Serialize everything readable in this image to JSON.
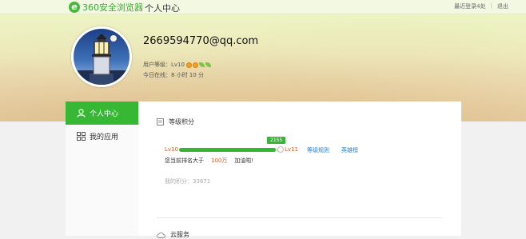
{
  "topbar": {
    "logo_text": "360安全浏览器",
    "page_title": "个人中心",
    "recent_login": "最近登录4处",
    "logout": "退出"
  },
  "user": {
    "email": "2669594770@qq.com",
    "level_label": "用户等级：Lv10",
    "online_label": "今日在线：8 小时 10 分"
  },
  "sidebar": {
    "items": [
      {
        "label": "个人中心",
        "icon": "user-icon",
        "active": true
      },
      {
        "label": "我的应用",
        "icon": "apps-grid-icon",
        "active": false
      }
    ]
  },
  "level_section": {
    "title": "等级积分",
    "current_level": "Lv10",
    "next_level": "Lv11",
    "progress_value": "2155",
    "progress_fraction": 0.95,
    "link_rules": "等级规则",
    "link_rank": "英雄榜",
    "rank_prefix": "您当前排名大于",
    "rank_value": "100万",
    "rank_suffix": "加油啦!",
    "points_text": "我的积分：33671"
  },
  "cloud_section": {
    "title": "云服务"
  },
  "colors": {
    "accent_green": "#37b834",
    "level_orange": "#e25a1f",
    "link_blue": "#2a7fc9"
  }
}
